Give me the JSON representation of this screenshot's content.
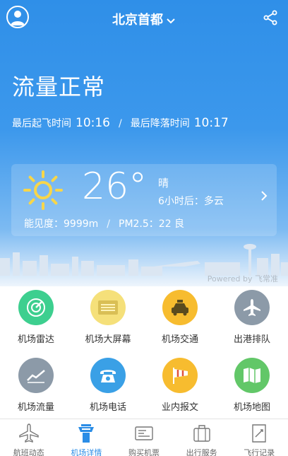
{
  "header": {
    "title": "北京首都",
    "avatar_icon": "user-avatar-icon",
    "share_icon": "share-icon"
  },
  "status": {
    "text": "流量正常",
    "last_takeoff_label": "最后起飞时间",
    "last_takeoff_time": "10:16",
    "last_landing_label": "最后降落时间",
    "last_landing_time": "10:17"
  },
  "weather": {
    "temperature": "26°",
    "condition": "晴",
    "forecast": "6小时后：多云",
    "visibility": "能见度：9999m",
    "pm25": "PM2.5：22 良",
    "icon": "sun-icon"
  },
  "powered_by": "Powered by 飞常准",
  "grid": [
    {
      "label": "机场雷达",
      "icon": "radar-icon",
      "color": "#3dcf8f"
    },
    {
      "label": "机场大屏幕",
      "icon": "display-board-icon",
      "color": "#f5e07a"
    },
    {
      "label": "机场交通",
      "icon": "taxi-icon",
      "color": "#f7bc2f"
    },
    {
      "label": "出港排队",
      "icon": "plane-icon",
      "color": "#8c9aa8"
    },
    {
      "label": "机场流量",
      "icon": "trend-chart-icon",
      "color": "#8c9aa8"
    },
    {
      "label": "机场电话",
      "icon": "phone-icon",
      "color": "#3aa0e6"
    },
    {
      "label": "业内报文",
      "icon": "windsock-icon",
      "color": "#f7bc2f"
    },
    {
      "label": "机场地图",
      "icon": "map-icon",
      "color": "#62c768"
    }
  ],
  "tabs": [
    {
      "label": "航班动态",
      "icon": "plane-icon",
      "active": false
    },
    {
      "label": "机场详情",
      "icon": "control-tower-icon",
      "active": true
    },
    {
      "label": "购买机票",
      "icon": "ticket-icon",
      "active": false
    },
    {
      "label": "出行服务",
      "icon": "suitcase-icon",
      "active": false
    },
    {
      "label": "飞行记录",
      "icon": "flight-record-icon",
      "active": false
    }
  ],
  "colors": {
    "hero_top": "#2f8fe8",
    "accent": "#2b8de6"
  }
}
